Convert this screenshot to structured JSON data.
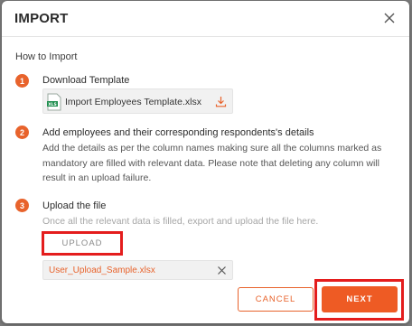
{
  "dialog": {
    "title": "IMPORT",
    "how_to": "How to Import"
  },
  "steps": [
    {
      "number": "1",
      "title": "Download Template",
      "template_file": "Import Employees Template.xlsx",
      "template_badge": "XLS"
    },
    {
      "number": "2",
      "title": "Add employees and their corresponding respondents's details",
      "description": "Add the details as per the column names making sure all the columns marked as mandatory are filled with relevant data. Please note that deleting any column will result in an upload failure."
    },
    {
      "number": "3",
      "title": "Upload the file",
      "description": "Once all the relevant data is filled, export and upload the file here.",
      "upload_label": "UPLOAD",
      "uploaded_file": "User_Upload_Sample.xlsx"
    }
  ],
  "footer": {
    "cancel_label": "CANCEL",
    "next_label": "NEXT"
  },
  "colors": {
    "accent": "#e8632c",
    "highlight": "#e41d1d"
  },
  "icons": {
    "close": "close-icon",
    "excel": "excel-file-icon",
    "download": "download-icon",
    "remove": "remove-file-icon"
  }
}
